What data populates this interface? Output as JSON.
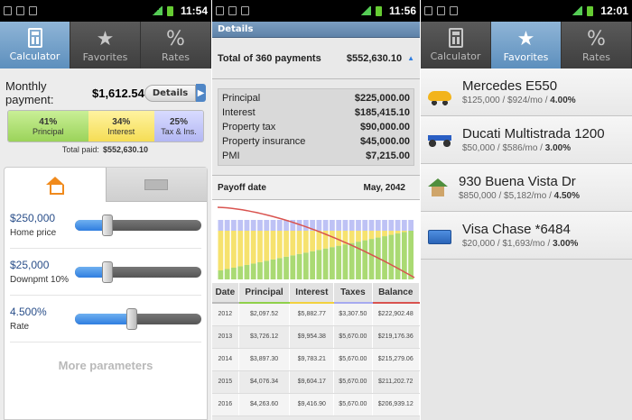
{
  "panel1": {
    "status": {
      "time": "11:54"
    },
    "tabs": [
      {
        "label": "Calculator",
        "icon": "calculator-icon",
        "active": true
      },
      {
        "label": "Favorites",
        "icon": "star-icon",
        "active": false
      },
      {
        "label": "Rates",
        "icon": "percent-icon",
        "active": false
      }
    ],
    "monthly_label": "Monthly payment:",
    "monthly_value": "$1,612.54",
    "details_label": "Details",
    "breakdown": [
      {
        "pct": "41%",
        "label": "Principal",
        "fraction": 0.41
      },
      {
        "pct": "34%",
        "label": "Interest",
        "fraction": 0.34
      },
      {
        "pct": "25%",
        "label": "Tax & Ins.",
        "fraction": 0.25
      }
    ],
    "total_paid_label": "Total paid:",
    "total_paid_value": "$552,630.10",
    "params": [
      {
        "value": "$250,000",
        "name": "Home price",
        "level": 0.26
      },
      {
        "value": "$25,000",
        "name": "Downpmt 10%",
        "level": 0.26
      },
      {
        "value": "4.500%",
        "name": "Rate",
        "level": 0.45
      }
    ],
    "more_label": "More parameters"
  },
  "panel2": {
    "status": {
      "time": "11:56"
    },
    "title": "Details",
    "total_label": "Total of 360 payments",
    "total_value": "$552,630.10",
    "rows": [
      {
        "label": "Principal",
        "value": "$225,000.00"
      },
      {
        "label": "Interest",
        "value": "$185,415.10"
      },
      {
        "label": "Property tax",
        "value": "$90,000.00"
      },
      {
        "label": "Property insurance",
        "value": "$45,000.00"
      },
      {
        "label": "PMI",
        "value": "$7,215.00"
      }
    ],
    "payoff_label": "Payoff date",
    "payoff_value": "May, 2042",
    "table_headers": [
      "Date",
      "Principal",
      "Interest",
      "Taxes",
      "Balance"
    ],
    "table_rows": [
      [
        "2012",
        "$2,097.52",
        "$5,882.77",
        "$3,307.50",
        "$222,902.48"
      ],
      [
        "2013",
        "$3,726.12",
        "$9,954.38",
        "$5,670.00",
        "$219,176.36"
      ],
      [
        "2014",
        "$3,897.30",
        "$9,783.21",
        "$5,670.00",
        "$215,279.06"
      ],
      [
        "2015",
        "$4,076.34",
        "$9,604.17",
        "$5,670.00",
        "$211,202.72"
      ],
      [
        "2016",
        "$4,263.60",
        "$9,416.90",
        "$5,670.00",
        "$206,939.12"
      ]
    ]
  },
  "panel3": {
    "status": {
      "time": "12:01"
    },
    "tabs": [
      {
        "label": "Calculator",
        "icon": "calculator-icon",
        "active": false
      },
      {
        "label": "Favorites",
        "icon": "star-icon",
        "active": true
      },
      {
        "label": "Rates",
        "icon": "percent-icon",
        "active": false
      }
    ],
    "favorites": [
      {
        "name": "Mercedes E550",
        "sub": "$125,000 / $924/mo / ",
        "rate": "4.00%",
        "icon": "car-icon"
      },
      {
        "name": "Ducati Multistrada 1200",
        "sub": "$50,000 / $586/mo / ",
        "rate": "3.00%",
        "icon": "motorcycle-icon"
      },
      {
        "name": "930 Buena Vista Dr",
        "sub": "$850,000 / $5,182/mo / ",
        "rate": "4.50%",
        "icon": "house-icon"
      },
      {
        "name": "Visa Chase *6484",
        "sub": "$20,000 / $1,693/mo / ",
        "rate": "3.00%",
        "icon": "credit-card-icon"
      }
    ]
  },
  "colors": {
    "principal": "#9bd35a",
    "interest": "#f5dd55",
    "tax": "#b3b7f3",
    "balance": "#d9534f",
    "accent": "#2f7ee0"
  }
}
